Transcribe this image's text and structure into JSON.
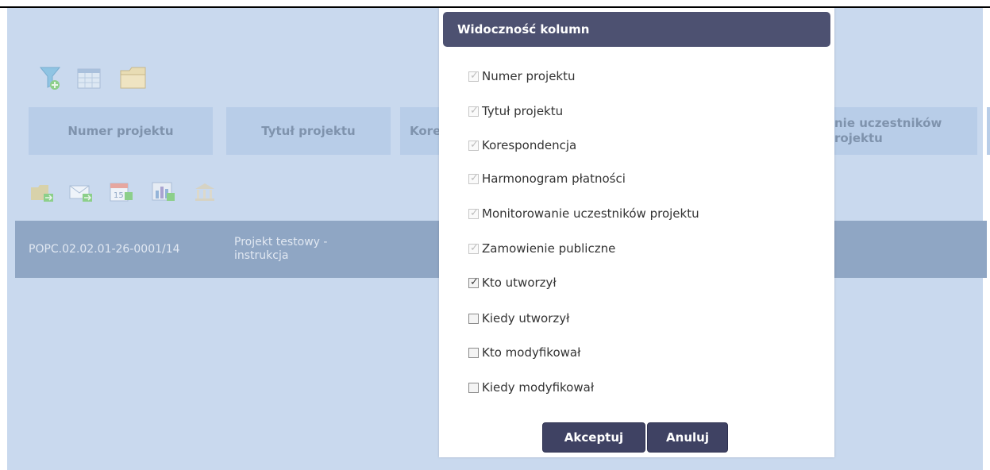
{
  "toolbar_icons": [
    "filter-add-icon",
    "table-icon",
    "folder-icon"
  ],
  "table": {
    "headers": [
      "Numer projektu",
      "Tytuł projektu",
      "Kore",
      "nie uczestników",
      "rojektu"
    ],
    "row_icons": [
      "folder-arrow-icon",
      "mail-arrow-icon",
      "calendar-icon",
      "chart-icon",
      "bank-icon"
    ],
    "row": {
      "numer": "POPC.02.02.01-26-0001/14",
      "tytul_line1": "Projekt testowy -",
      "tytul_line2": "instrukcja"
    }
  },
  "modal": {
    "title": "Widoczność kolumn",
    "options": [
      {
        "label": "Numer projektu",
        "checked": true,
        "disabled": true
      },
      {
        "label": "Tytuł projektu",
        "checked": true,
        "disabled": true
      },
      {
        "label": "Korespondencja",
        "checked": true,
        "disabled": true
      },
      {
        "label": "Harmonogram płatności",
        "checked": true,
        "disabled": true
      },
      {
        "label": "Monitorowanie uczestników projektu",
        "checked": true,
        "disabled": true
      },
      {
        "label": "Zamowienie publiczne",
        "checked": true,
        "disabled": true
      },
      {
        "label": "Kto utworzył",
        "checked": true,
        "disabled": false
      },
      {
        "label": "Kiedy utworzył",
        "checked": false,
        "disabled": false
      },
      {
        "label": "Kto modyfikował",
        "checked": false,
        "disabled": false
      },
      {
        "label": "Kiedy modyfikował",
        "checked": false,
        "disabled": false
      }
    ],
    "accept_label": "Akceptuj",
    "cancel_label": "Anuluj"
  },
  "colors": {
    "overlay_bg": "#c9d9ee",
    "header_bg": "#b8cde8",
    "row_bg": "#8fa6c4",
    "modal_title_bg": "#4d5171",
    "button_bg": "#3f4263"
  }
}
